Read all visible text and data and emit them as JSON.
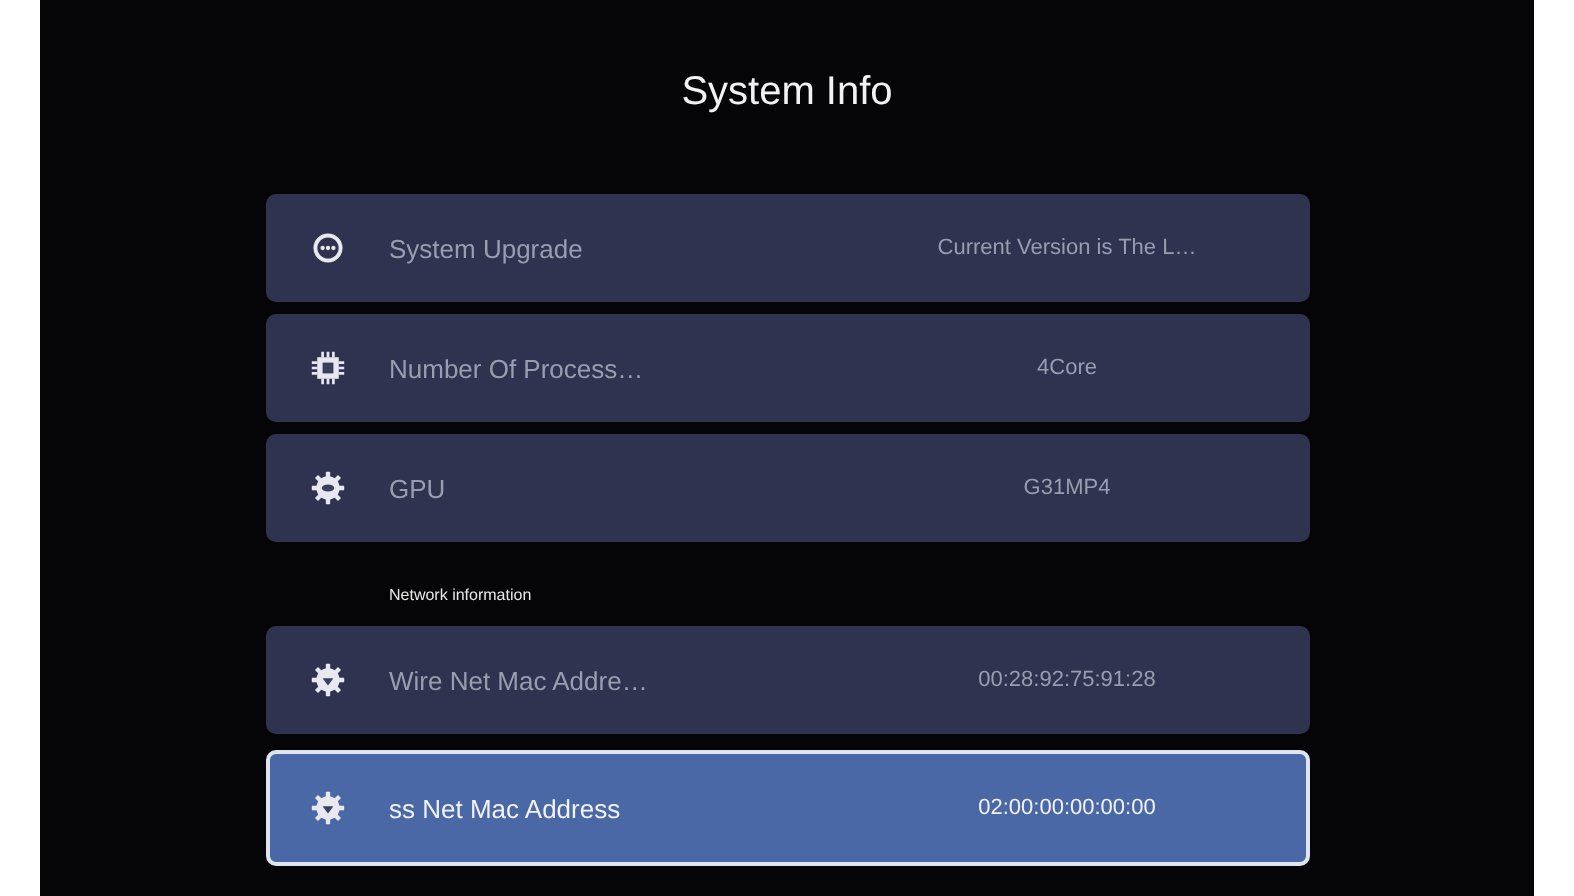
{
  "title": "System Info",
  "groups": [
    {
      "items": [
        {
          "kind": "upgrade",
          "label": "System Upgrade",
          "value": "Current Version is The L…",
          "selected": false
        },
        {
          "kind": "chip",
          "label": "Number Of Process…",
          "value": "4Core",
          "selected": false
        },
        {
          "kind": "gear",
          "label": "GPU",
          "value": "G31MP4",
          "selected": false
        }
      ]
    },
    {
      "heading": "Network information",
      "items": [
        {
          "kind": "network",
          "label": "Wire Net Mac Addre…",
          "value": "00:28:92:75:91:28",
          "selected": false
        },
        {
          "kind": "network",
          "label": "ss Net Mac Address",
          "value": "02:00:00:00:00:00",
          "selected": true
        }
      ]
    }
  ]
}
